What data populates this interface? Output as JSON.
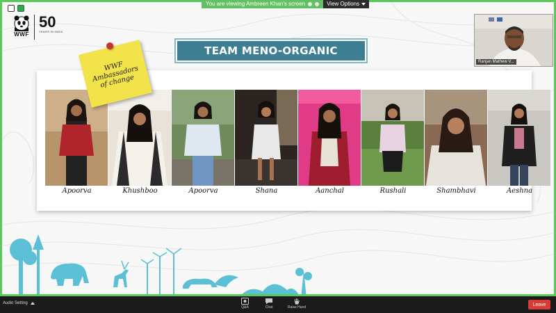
{
  "app": {
    "share_banner": "You are viewing Ambreen Khan's screen",
    "view_options": "View Options"
  },
  "logo": {
    "brand": "WWF",
    "anniversary": "50",
    "anniversary_sub": "YEARS IN INDIA"
  },
  "slide": {
    "title": "TEAM MENO-ORGANIC",
    "sticky_note": "WWF Ambassadors of change",
    "members": [
      {
        "name": "Apoorva"
      },
      {
        "name": "Khushboo"
      },
      {
        "name": "Apoorva"
      },
      {
        "name": "Shana"
      },
      {
        "name": "Aanchal"
      },
      {
        "name": "Rushali"
      },
      {
        "name": "Shambhavi"
      },
      {
        "name": "Aeshna"
      }
    ]
  },
  "video": {
    "participant_name": "Ranjan Mathew V..."
  },
  "toolbar": {
    "audio_setting": "Audio Setting",
    "qa": "Q&A",
    "chat": "Chat",
    "raise_hand": "Raise Hand",
    "leave": "Leave"
  },
  "colors": {
    "share_border": "#5ac85a",
    "title_bg": "#3d7e93",
    "sticky": "#f3e34a",
    "leave": "#d83b34",
    "wildlife": "#5bbfd6"
  }
}
